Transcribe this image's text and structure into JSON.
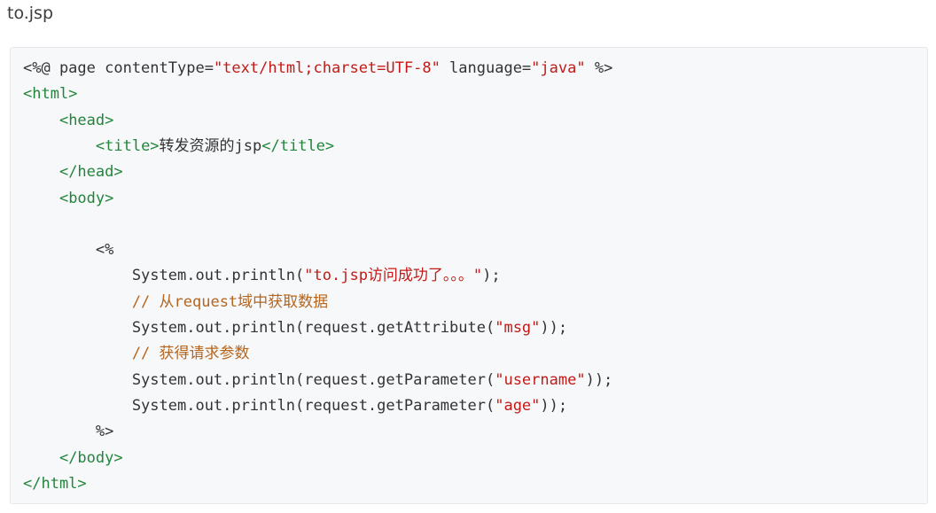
{
  "file_title": "to.jsp",
  "code": {
    "lines": [
      [
        {
          "t": "<%@ page contentType=",
          "c": "plain"
        },
        {
          "t": "\"text/html;charset=UTF-8\"",
          "c": "str"
        },
        {
          "t": " language=",
          "c": "plain"
        },
        {
          "t": "\"java\"",
          "c": "str"
        },
        {
          "t": " %>",
          "c": "plain"
        }
      ],
      [
        {
          "t": "<html>",
          "c": "tag"
        }
      ],
      [
        {
          "t": "    ",
          "c": "plain"
        },
        {
          "t": "<head>",
          "c": "tag"
        }
      ],
      [
        {
          "t": "        ",
          "c": "plain"
        },
        {
          "t": "<title>",
          "c": "tag"
        },
        {
          "t": "转发资源的jsp",
          "c": "plain"
        },
        {
          "t": "</title>",
          "c": "tag"
        }
      ],
      [
        {
          "t": "    ",
          "c": "plain"
        },
        {
          "t": "</head>",
          "c": "tag"
        }
      ],
      [
        {
          "t": "    ",
          "c": "plain"
        },
        {
          "t": "<body>",
          "c": "tag"
        }
      ],
      [],
      [
        {
          "t": "        <%",
          "c": "plain"
        }
      ],
      [
        {
          "t": "            System.out.println(",
          "c": "plain"
        },
        {
          "t": "\"to.jsp访问成功了。。。\"",
          "c": "str"
        },
        {
          "t": ");",
          "c": "plain"
        }
      ],
      [
        {
          "t": "            // 从request域中获取数据",
          "c": "comment"
        }
      ],
      [
        {
          "t": "            System.out.println(request.getAttribute(",
          "c": "plain"
        },
        {
          "t": "\"msg\"",
          "c": "str"
        },
        {
          "t": "));",
          "c": "plain"
        }
      ],
      [
        {
          "t": "            // 获得请求参数",
          "c": "comment"
        }
      ],
      [
        {
          "t": "            System.out.println(request.getParameter(",
          "c": "plain"
        },
        {
          "t": "\"username\"",
          "c": "str"
        },
        {
          "t": "));",
          "c": "plain"
        }
      ],
      [
        {
          "t": "            System.out.println(request.getParameter(",
          "c": "plain"
        },
        {
          "t": "\"age\"",
          "c": "str"
        },
        {
          "t": "));",
          "c": "plain"
        }
      ],
      [
        {
          "t": "        %>",
          "c": "plain"
        }
      ],
      [
        {
          "t": "    ",
          "c": "plain"
        },
        {
          "t": "</body>",
          "c": "tag"
        }
      ],
      [
        {
          "t": "</html>",
          "c": "tag"
        }
      ]
    ]
  }
}
